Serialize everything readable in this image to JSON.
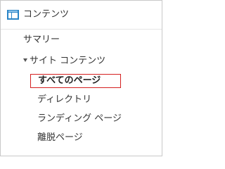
{
  "section": {
    "title": "コンテンツ",
    "icon": "content-report-icon",
    "icon_color": "#2a85c7"
  },
  "nav": {
    "summary": "サマリー",
    "site_content": "サイト コンテンツ",
    "expanded_indicator": "caret-down-icon",
    "children": {
      "all_pages": "すべてのページ",
      "directory": "ディレクトリ",
      "landing_pages": "ランディング ページ",
      "exit_pages": "離脱ページ"
    },
    "selected": "all_pages",
    "highlight_color": "#d42020"
  }
}
